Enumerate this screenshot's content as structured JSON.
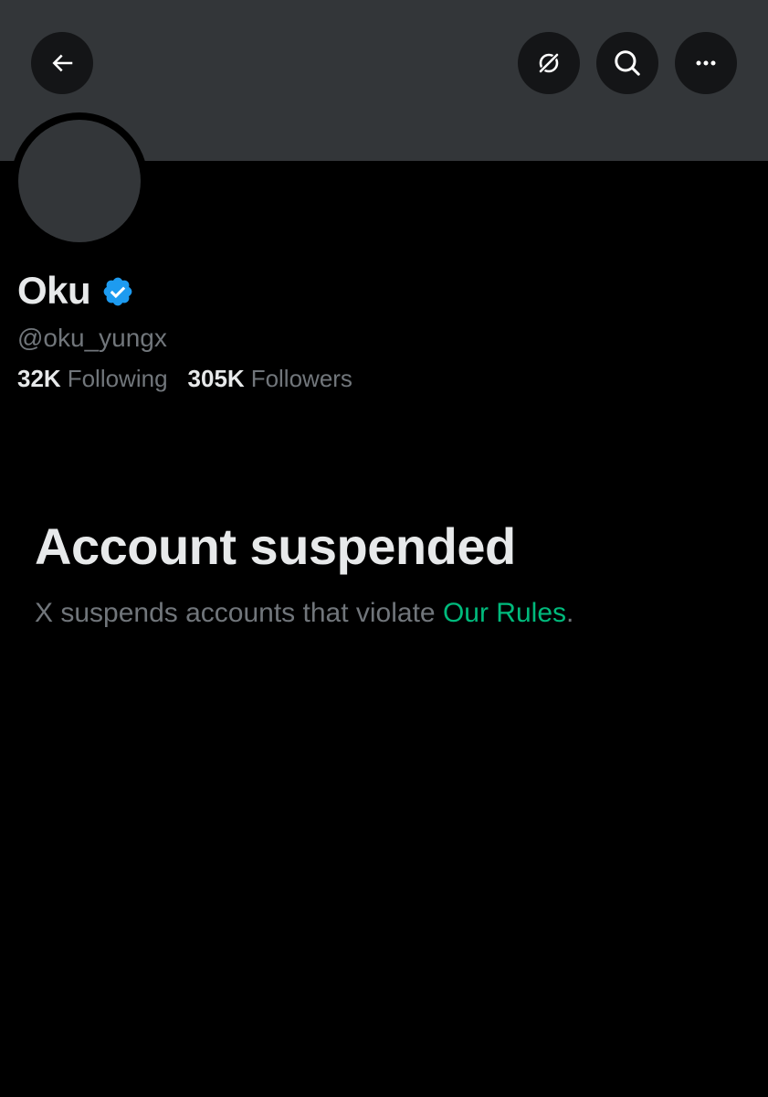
{
  "header": {
    "back_icon": "arrow-left-icon",
    "grok_icon": "grok-icon",
    "search_icon": "search-icon",
    "more_icon": "more-horizontal-icon"
  },
  "profile": {
    "display_name": "Oku",
    "verified": true,
    "verified_color": "#1d9bf0",
    "handle": "@oku_yungx",
    "following_count": "32K",
    "following_label": "Following",
    "followers_count": "305K",
    "followers_label": "Followers"
  },
  "suspension": {
    "title": "Account suspended",
    "message_prefix": "X suspends accounts that violate ",
    "link_label": "Our Rules",
    "message_suffix": ".",
    "link_color": "#00ba7c"
  },
  "colors": {
    "background": "#000000",
    "banner": "#333639",
    "primary_text": "#e7e9ea",
    "secondary_text": "#71767b"
  }
}
